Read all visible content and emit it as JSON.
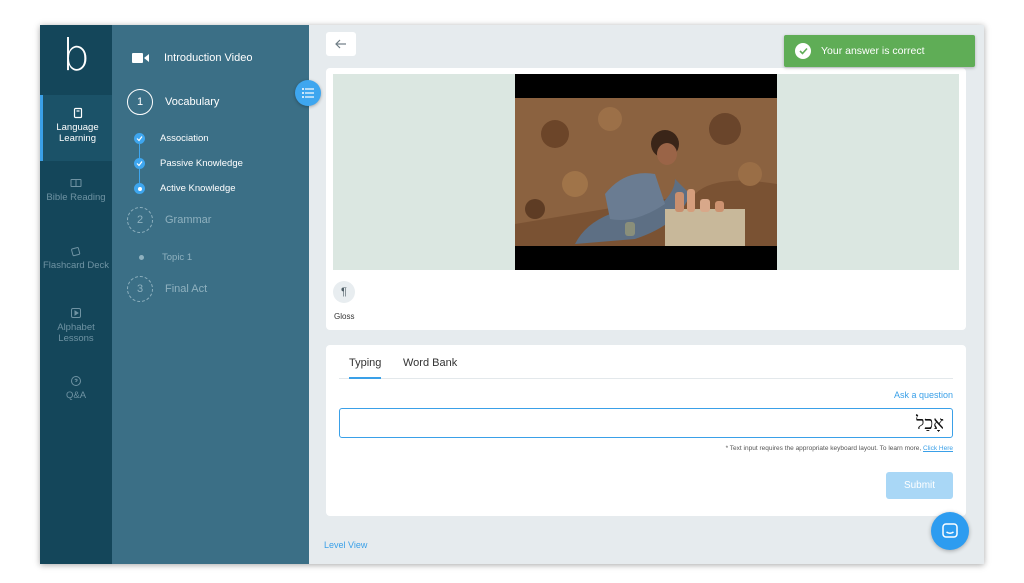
{
  "brand": {
    "logo_letter": "b"
  },
  "rail": {
    "items": [
      {
        "label_1": "Language",
        "label_2": "Learning",
        "icon": "book-icon",
        "active": true
      },
      {
        "label_1": "Bible Reading",
        "label_2": "",
        "icon": "open-book-icon",
        "active": false
      },
      {
        "label_1": "Flashcard Deck",
        "label_2": "",
        "icon": "flashcard-icon",
        "active": false
      },
      {
        "label_1": "Alphabet",
        "label_2": "Lessons",
        "icon": "play-square-icon",
        "active": false
      },
      {
        "label_1": "Q&A",
        "label_2": "",
        "icon": "question-icon",
        "active": false
      }
    ]
  },
  "tree": {
    "intro": {
      "label": "Introduction Video",
      "icon": "video-camera-icon"
    },
    "sections": [
      {
        "num": "1",
        "label": "Vocabulary"
      },
      {
        "num": "2",
        "label": "Grammar"
      },
      {
        "num": "3",
        "label": "Final Act"
      }
    ],
    "vocab_steps": [
      {
        "label": "Association"
      },
      {
        "label": "Passive Knowledge"
      },
      {
        "label": "Active Knowledge"
      }
    ],
    "grammar_topics": [
      {
        "label": "Topic 1"
      }
    ]
  },
  "main": {
    "gloss_label": "Gloss",
    "tabs": [
      {
        "label": "Typing"
      },
      {
        "label": "Word Bank"
      }
    ],
    "ask_question": "Ask a question",
    "answer_value": "אָכַל",
    "hint_text": "* Text input requires the appropriate keyboard layout. To learn more,",
    "hint_link": "Click Here",
    "submit_label": "Submit",
    "level_view": "Level View"
  },
  "toast": {
    "message": "Your answer is correct"
  },
  "colors": {
    "accent": "#3aa0e8",
    "rail": "#14465a",
    "panel": "#3b6f86",
    "success": "#5fad56"
  }
}
